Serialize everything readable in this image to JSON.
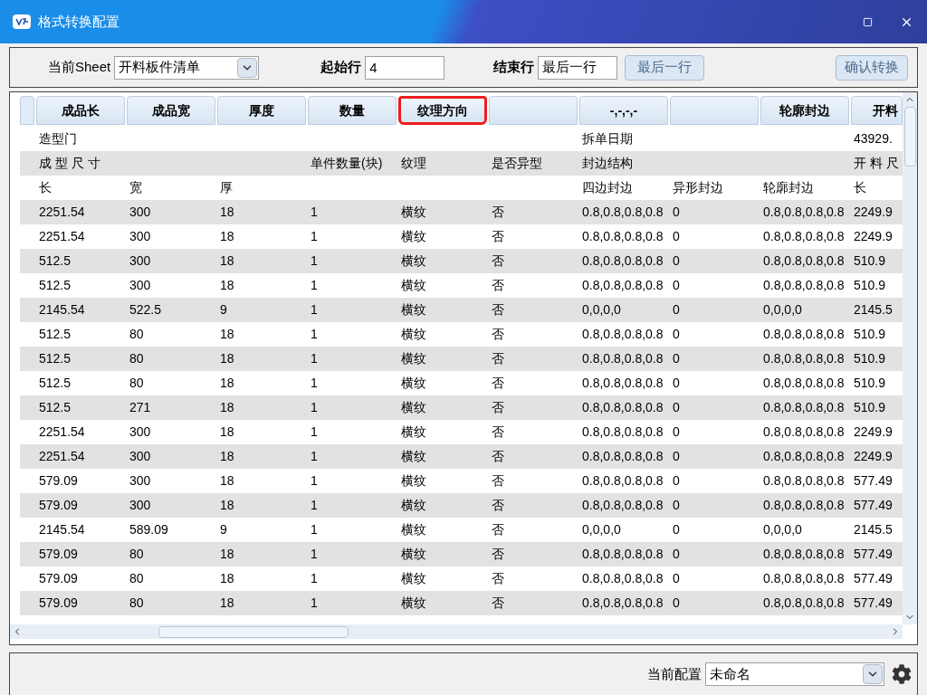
{
  "window": {
    "title": "格式转换配置"
  },
  "toolbar": {
    "sheet_label": "当前Sheet",
    "sheet_value": "开料板件清单",
    "start_label": "起始行",
    "start_value": "4",
    "end_label": "结束行",
    "end_value": "最后一行",
    "last_row_button": "最后一行",
    "confirm_button": "确认转换"
  },
  "table": {
    "columns": [
      {
        "label": "成品长",
        "selected": false
      },
      {
        "label": "成品宽",
        "selected": false
      },
      {
        "label": "厚度",
        "selected": false
      },
      {
        "label": "数量",
        "selected": false
      },
      {
        "label": "纹理方向",
        "selected": true
      },
      {
        "selected": false
      },
      {
        "label": "-,-,-,-",
        "selected": false
      },
      {
        "selected": false
      },
      {
        "label": "轮廓封边",
        "selected": false
      },
      {
        "label": "开料",
        "selected": false
      }
    ],
    "rows": [
      {
        "column_1": "造型门",
        "column_7": "拆单日期",
        "column_10": "43929."
      },
      {
        "column_1": "成 型 尺 寸",
        "column_4": "单件数量(块)",
        "column_5": "纹理",
        "column_6": "是否异型",
        "column_7": "封边结构",
        "column_10": "开 料 尺"
      },
      {
        "column_1": "长",
        "column_2": "宽",
        "column_3": "厚",
        "column_7": "四边封边",
        "column_8": "异形封边",
        "column_9": "轮廓封边",
        "column_10": "长"
      },
      {
        "column_1": "2251.54",
        "column_2": "300",
        "column_3": "18",
        "column_4": "1",
        "column_5": "横纹",
        "column_6": "否",
        "column_7": "0.8,0.8,0.8,0.8",
        "column_8": "0",
        "column_9": "0.8,0.8,0.8,0.8",
        "column_10": "2249.9"
      },
      {
        "column_1": "2251.54",
        "column_2": "300",
        "column_3": "18",
        "column_4": "1",
        "column_5": "横纹",
        "column_6": "否",
        "column_7": "0.8,0.8,0.8,0.8",
        "column_8": "0",
        "column_9": "0.8,0.8,0.8,0.8",
        "column_10": "2249.9"
      },
      {
        "column_1": "512.5",
        "column_2": "300",
        "column_3": "18",
        "column_4": "1",
        "column_5": "横纹",
        "column_6": "否",
        "column_7": "0.8,0.8,0.8,0.8",
        "column_8": "0",
        "column_9": "0.8,0.8,0.8,0.8",
        "column_10": "510.9"
      },
      {
        "column_1": "512.5",
        "column_2": "300",
        "column_3": "18",
        "column_4": "1",
        "column_5": "横纹",
        "column_6": "否",
        "column_7": "0.8,0.8,0.8,0.8",
        "column_8": "0",
        "column_9": "0.8,0.8,0.8,0.8",
        "column_10": "510.9"
      },
      {
        "column_1": "2145.54",
        "column_2": "522.5",
        "column_3": "9",
        "column_4": "1",
        "column_5": "横纹",
        "column_6": "否",
        "column_7": "0,0,0,0",
        "column_8": "0",
        "column_9": "0,0,0,0",
        "column_10": "2145.5"
      },
      {
        "column_1": "512.5",
        "column_2": "80",
        "column_3": "18",
        "column_4": "1",
        "column_5": "横纹",
        "column_6": "否",
        "column_7": "0.8,0.8,0.8,0.8",
        "column_8": "0",
        "column_9": "0.8,0.8,0.8,0.8",
        "column_10": "510.9"
      },
      {
        "column_1": "512.5",
        "column_2": "80",
        "column_3": "18",
        "column_4": "1",
        "column_5": "横纹",
        "column_6": "否",
        "column_7": "0.8,0.8,0.8,0.8",
        "column_8": "0",
        "column_9": "0.8,0.8,0.8,0.8",
        "column_10": "510.9"
      },
      {
        "column_1": "512.5",
        "column_2": "80",
        "column_3": "18",
        "column_4": "1",
        "column_5": "横纹",
        "column_6": "否",
        "column_7": "0.8,0.8,0.8,0.8",
        "column_8": "0",
        "column_9": "0.8,0.8,0.8,0.8",
        "column_10": "510.9"
      },
      {
        "column_1": "512.5",
        "column_2": "271",
        "column_3": "18",
        "column_4": "1",
        "column_5": "横纹",
        "column_6": "否",
        "column_7": "0.8,0.8,0.8,0.8",
        "column_8": "0",
        "column_9": "0.8,0.8,0.8,0.8",
        "column_10": "510.9"
      },
      {
        "column_1": "2251.54",
        "column_2": "300",
        "column_3": "18",
        "column_4": "1",
        "column_5": "横纹",
        "column_6": "否",
        "column_7": "0.8,0.8,0.8,0.8",
        "column_8": "0",
        "column_9": "0.8,0.8,0.8,0.8",
        "column_10": "2249.9"
      },
      {
        "column_1": "2251.54",
        "column_2": "300",
        "column_3": "18",
        "column_4": "1",
        "column_5": "横纹",
        "column_6": "否",
        "column_7": "0.8,0.8,0.8,0.8",
        "column_8": "0",
        "column_9": "0.8,0.8,0.8,0.8",
        "column_10": "2249.9"
      },
      {
        "column_1": "579.09",
        "column_2": "300",
        "column_3": "18",
        "column_4": "1",
        "column_5": "横纹",
        "column_6": "否",
        "column_7": "0.8,0.8,0.8,0.8",
        "column_8": "0",
        "column_9": "0.8,0.8,0.8,0.8",
        "column_10": "577.49"
      },
      {
        "column_1": "579.09",
        "column_2": "300",
        "column_3": "18",
        "column_4": "1",
        "column_5": "横纹",
        "column_6": "否",
        "column_7": "0.8,0.8,0.8,0.8",
        "column_8": "0",
        "column_9": "0.8,0.8,0.8,0.8",
        "column_10": "577.49"
      },
      {
        "column_1": "2145.54",
        "column_2": "589.09",
        "column_3": "9",
        "column_4": "1",
        "column_5": "横纹",
        "column_6": "否",
        "column_7": "0,0,0,0",
        "column_8": "0",
        "column_9": "0,0,0,0",
        "column_10": "2145.5"
      },
      {
        "column_1": "579.09",
        "column_2": "80",
        "column_3": "18",
        "column_4": "1",
        "column_5": "横纹",
        "column_6": "否",
        "column_7": "0.8,0.8,0.8,0.8",
        "column_8": "0",
        "column_9": "0.8,0.8,0.8,0.8",
        "column_10": "577.49"
      },
      {
        "column_1": "579.09",
        "column_2": "80",
        "column_3": "18",
        "column_4": "1",
        "column_5": "横纹",
        "column_6": "否",
        "column_7": "0.8,0.8,0.8,0.8",
        "column_8": "0",
        "column_9": "0.8,0.8,0.8,0.8",
        "column_10": "577.49"
      },
      {
        "column_1": "579.09",
        "column_2": "80",
        "column_3": "18",
        "column_4": "1",
        "column_5": "横纹",
        "column_6": "否",
        "column_7": "0.8,0.8,0.8,0.8",
        "column_8": "0",
        "column_9": "0.8,0.8,0.8,0.8",
        "column_10": "577.49"
      }
    ]
  },
  "footer": {
    "config_label": "当前配置",
    "config_value": "未命名"
  }
}
